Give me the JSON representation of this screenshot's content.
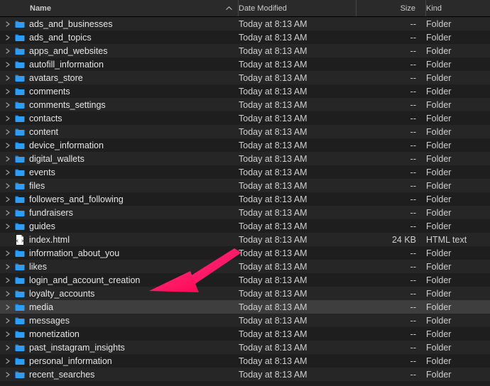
{
  "columns": {
    "name": "Name",
    "date": "Date Modified",
    "size": "Size",
    "kind": "Kind"
  },
  "colors": {
    "folder": "#2e9df7",
    "folder_tab": "#1c7ed6",
    "arrow": "#ff2d7a",
    "html_page": "#ffffff",
    "html_spine": "#b0b0b0"
  },
  "selected_index": 21,
  "rows": [
    {
      "name": "ads_and_businesses",
      "date": "Today at 8:13 AM",
      "size": "--",
      "kind": "Folder",
      "type": "folder"
    },
    {
      "name": "ads_and_topics",
      "date": "Today at 8:13 AM",
      "size": "--",
      "kind": "Folder",
      "type": "folder"
    },
    {
      "name": "apps_and_websites",
      "date": "Today at 8:13 AM",
      "size": "--",
      "kind": "Folder",
      "type": "folder"
    },
    {
      "name": "autofill_information",
      "date": "Today at 8:13 AM",
      "size": "--",
      "kind": "Folder",
      "type": "folder"
    },
    {
      "name": "avatars_store",
      "date": "Today at 8:13 AM",
      "size": "--",
      "kind": "Folder",
      "type": "folder"
    },
    {
      "name": "comments",
      "date": "Today at 8:13 AM",
      "size": "--",
      "kind": "Folder",
      "type": "folder"
    },
    {
      "name": "comments_settings",
      "date": "Today at 8:13 AM",
      "size": "--",
      "kind": "Folder",
      "type": "folder"
    },
    {
      "name": "contacts",
      "date": "Today at 8:13 AM",
      "size": "--",
      "kind": "Folder",
      "type": "folder"
    },
    {
      "name": "content",
      "date": "Today at 8:13 AM",
      "size": "--",
      "kind": "Folder",
      "type": "folder"
    },
    {
      "name": "device_information",
      "date": "Today at 8:13 AM",
      "size": "--",
      "kind": "Folder",
      "type": "folder"
    },
    {
      "name": "digital_wallets",
      "date": "Today at 8:13 AM",
      "size": "--",
      "kind": "Folder",
      "type": "folder"
    },
    {
      "name": "events",
      "date": "Today at 8:13 AM",
      "size": "--",
      "kind": "Folder",
      "type": "folder"
    },
    {
      "name": "files",
      "date": "Today at 8:13 AM",
      "size": "--",
      "kind": "Folder",
      "type": "folder"
    },
    {
      "name": "followers_and_following",
      "date": "Today at 8:13 AM",
      "size": "--",
      "kind": "Folder",
      "type": "folder"
    },
    {
      "name": "fundraisers",
      "date": "Today at 8:13 AM",
      "size": "--",
      "kind": "Folder",
      "type": "folder"
    },
    {
      "name": "guides",
      "date": "Today at 8:13 AM",
      "size": "--",
      "kind": "Folder",
      "type": "folder"
    },
    {
      "name": "index.html",
      "date": "Today at 8:13 AM",
      "size": "24 KB",
      "kind": "HTML text",
      "type": "html"
    },
    {
      "name": "information_about_you",
      "date": "Today at 8:13 AM",
      "size": "--",
      "kind": "Folder",
      "type": "folder"
    },
    {
      "name": "likes",
      "date": "Today at 8:13 AM",
      "size": "--",
      "kind": "Folder",
      "type": "folder"
    },
    {
      "name": "login_and_account_creation",
      "date": "Today at 8:13 AM",
      "size": "--",
      "kind": "Folder",
      "type": "folder"
    },
    {
      "name": "loyalty_accounts",
      "date": "Today at 8:13 AM",
      "size": "--",
      "kind": "Folder",
      "type": "folder"
    },
    {
      "name": "media",
      "date": "Today at 8:13 AM",
      "size": "--",
      "kind": "Folder",
      "type": "folder"
    },
    {
      "name": "messages",
      "date": "Today at 8:13 AM",
      "size": "--",
      "kind": "Folder",
      "type": "folder"
    },
    {
      "name": "monetization",
      "date": "Today at 8:13 AM",
      "size": "--",
      "kind": "Folder",
      "type": "folder"
    },
    {
      "name": "past_instagram_insights",
      "date": "Today at 8:13 AM",
      "size": "--",
      "kind": "Folder",
      "type": "folder"
    },
    {
      "name": "personal_information",
      "date": "Today at 8:13 AM",
      "size": "--",
      "kind": "Folder",
      "type": "folder"
    },
    {
      "name": "recent_searches",
      "date": "Today at 8:13 AM",
      "size": "--",
      "kind": "Folder",
      "type": "folder"
    }
  ]
}
